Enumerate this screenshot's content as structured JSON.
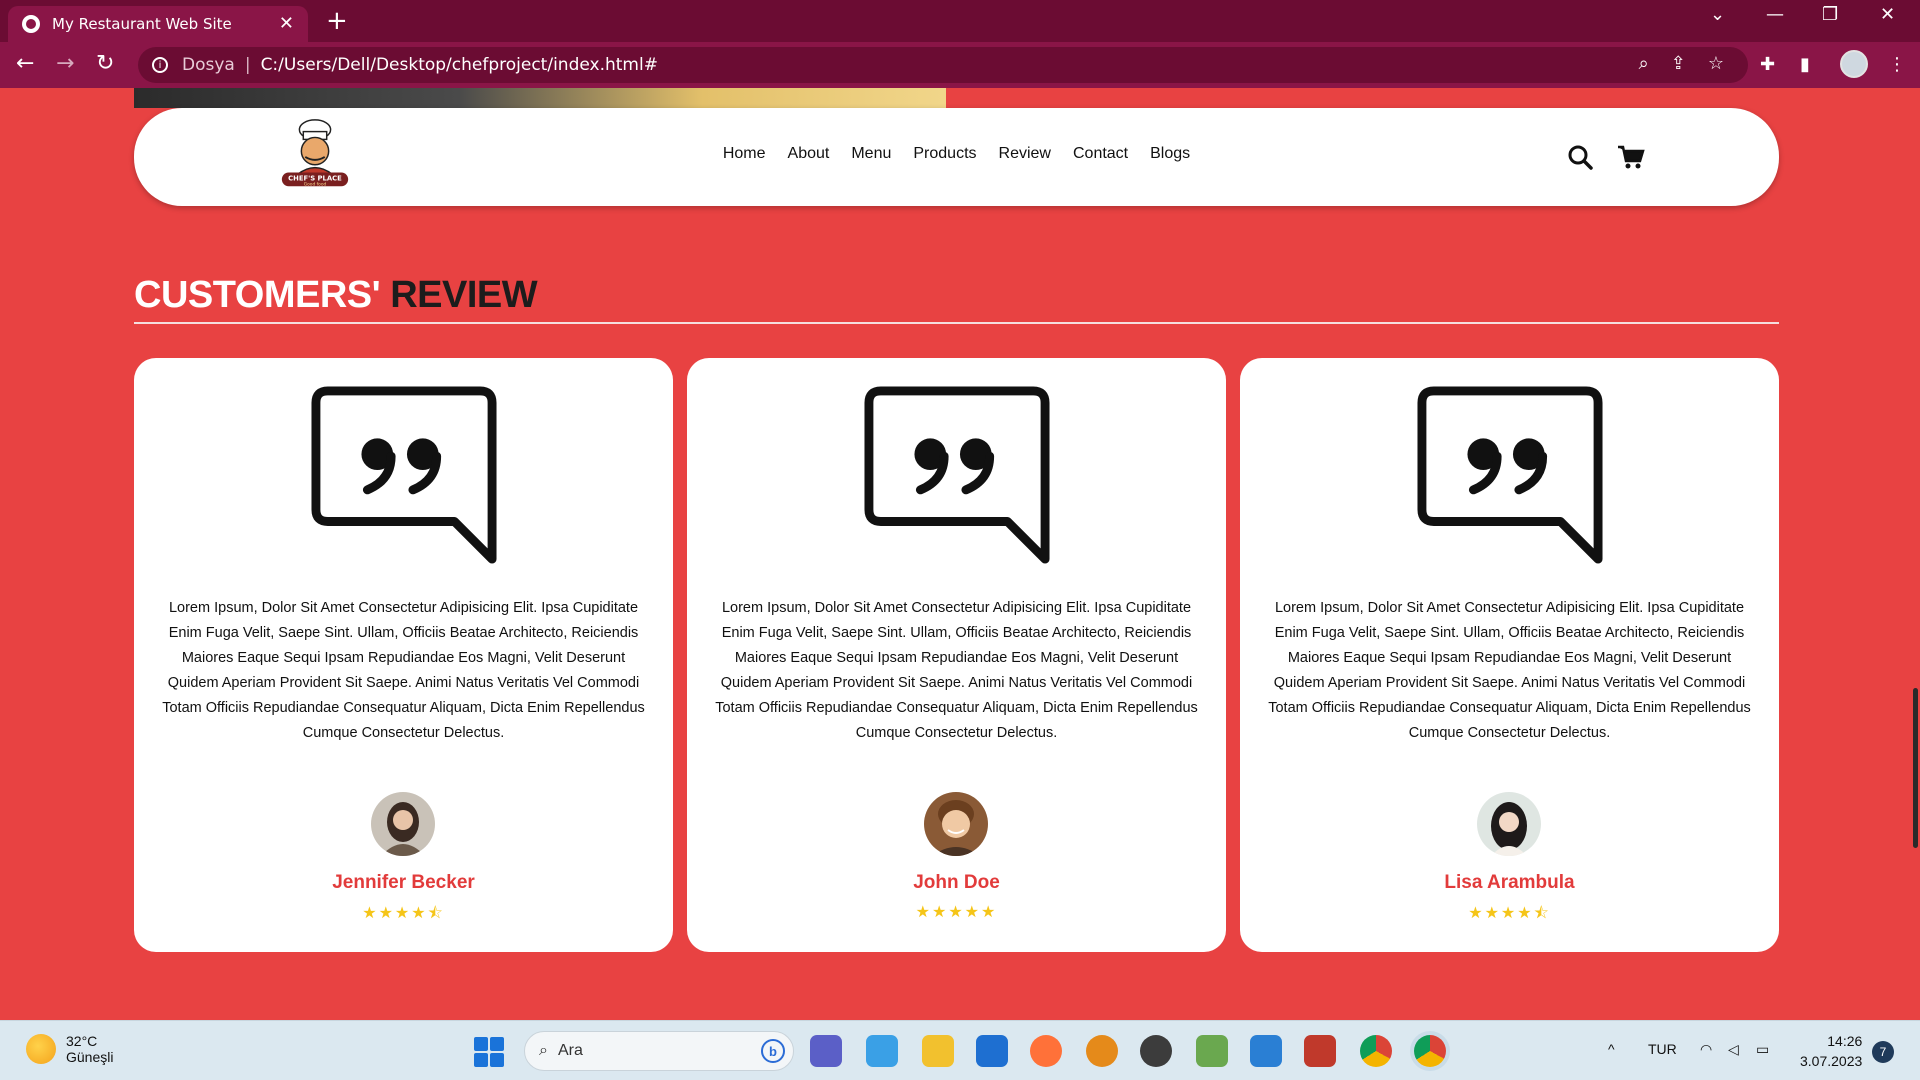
{
  "browser": {
    "tab_title": "My Restaurant Web Site",
    "url_scheme_label": "Dosya",
    "url": "C:/Users/Dell/Desktop/chefproject/index.html#"
  },
  "site": {
    "logo_text": "CHEF'S PLACE",
    "logo_subtext": "Good food",
    "nav": [
      "Home",
      "About",
      "Menu",
      "Products",
      "Review",
      "Contact",
      "Blogs"
    ]
  },
  "reviews_section": {
    "title_part1": "CUSTOMERS'",
    "title_part2": " REVIEW",
    "reviews": [
      {
        "text": "Lorem Ipsum, Dolor Sit Amet Consectetur Adipisicing Elit. Ipsa Cupiditate Enim Fuga Velit, Saepe Sint. Ullam, Officiis Beatae Architecto, Reiciendis Maiores Eaque Sequi Ipsam Repudiandae Eos Magni, Velit Deserunt Quidem Aperiam Provident Sit Saepe. Animi Natus Veritatis Vel Commodi Totam Officiis Repudiandae Consequatur Aliquam, Dicta Enim Repellendus Cumque Consectetur Delectus.",
        "name": "Jennifer Becker",
        "rating": 4.5,
        "stars": "★★★★⯪"
      },
      {
        "text": "Lorem Ipsum, Dolor Sit Amet Consectetur Adipisicing Elit. Ipsa Cupiditate Enim Fuga Velit, Saepe Sint. Ullam, Officiis Beatae Architecto, Reiciendis Maiores Eaque Sequi Ipsam Repudiandae Eos Magni, Velit Deserunt Quidem Aperiam Provident Sit Saepe. Animi Natus Veritatis Vel Commodi Totam Officiis Repudiandae Consequatur Aliquam, Dicta Enim Repellendus Cumque Consectetur Delectus.",
        "name": "John Doe",
        "rating": 5,
        "stars": "★★★★★"
      },
      {
        "text": "Lorem Ipsum, Dolor Sit Amet Consectetur Adipisicing Elit. Ipsa Cupiditate Enim Fuga Velit, Saepe Sint. Ullam, Officiis Beatae Architecto, Reiciendis Maiores Eaque Sequi Ipsam Repudiandae Eos Magni, Velit Deserunt Quidem Aperiam Provident Sit Saepe. Animi Natus Veritatis Vel Commodi Totam Officiis Repudiandae Consequatur Aliquam, Dicta Enim Repellendus Cumque Consectetur Delectus.",
        "name": "Lisa Arambula",
        "rating": 4.5,
        "stars": "★★★★⯪"
      }
    ]
  },
  "taskbar": {
    "weather_temp": "32°C",
    "weather_desc": "Güneşli",
    "search_placeholder": "Ara",
    "language": "TUR",
    "time": "14:26",
    "date": "3.07.2023",
    "notification_count": "7"
  },
  "colors": {
    "page_bg": "#e84242",
    "accent_name": "#e23b3b",
    "browser_frame": "#8a1547",
    "star": "#f5c518"
  }
}
